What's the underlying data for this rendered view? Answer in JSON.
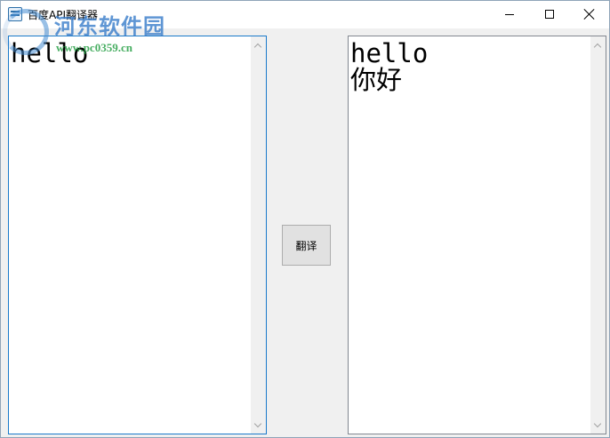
{
  "window": {
    "title": "百度API翻译器",
    "controls": {
      "minimize": "minimize-icon",
      "maximize": "maximize-icon",
      "close": "close-icon"
    }
  },
  "watermark": {
    "site_name": "河东软件园",
    "url": "www.pc0359.cn"
  },
  "input": {
    "text": "hello"
  },
  "output": {
    "text": "hello\n你好"
  },
  "translate_button": {
    "label": "翻译"
  },
  "colors": {
    "focus_border": "#1979ca",
    "window_bg": "#f0f0f0"
  }
}
